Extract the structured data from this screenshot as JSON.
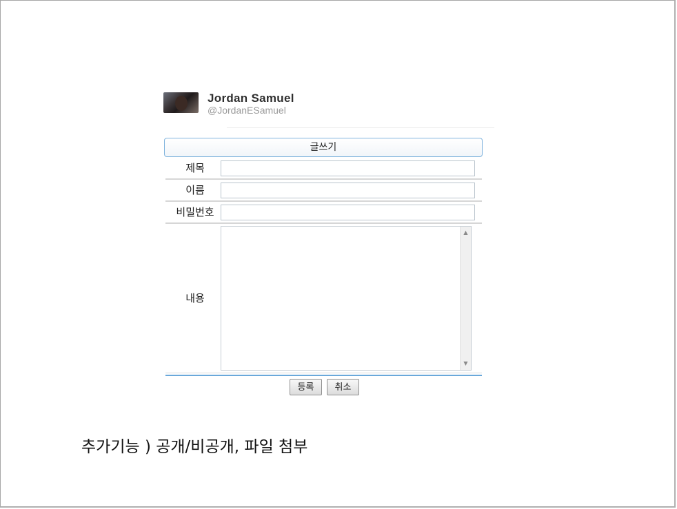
{
  "profile": {
    "name": "Jordan Samuel",
    "handle": "@JordanESamuel"
  },
  "form": {
    "header": "글쓰기",
    "fields": {
      "title_label": "제목",
      "name_label": "이름",
      "password_label": "비밀번호",
      "content_label": "내용"
    },
    "values": {
      "title": "",
      "name": "",
      "password": "",
      "content": ""
    },
    "buttons": {
      "submit": "등록",
      "cancel": "취소"
    }
  },
  "note": "추가기능 ) 공개/비공개, 파일 첨부",
  "icons": {
    "scroll_up": "arrow-up-icon",
    "scroll_down": "arrow-down-icon"
  },
  "colors": {
    "accent_border": "#7fb3dd",
    "bottom_rule": "#6aa8da"
  }
}
